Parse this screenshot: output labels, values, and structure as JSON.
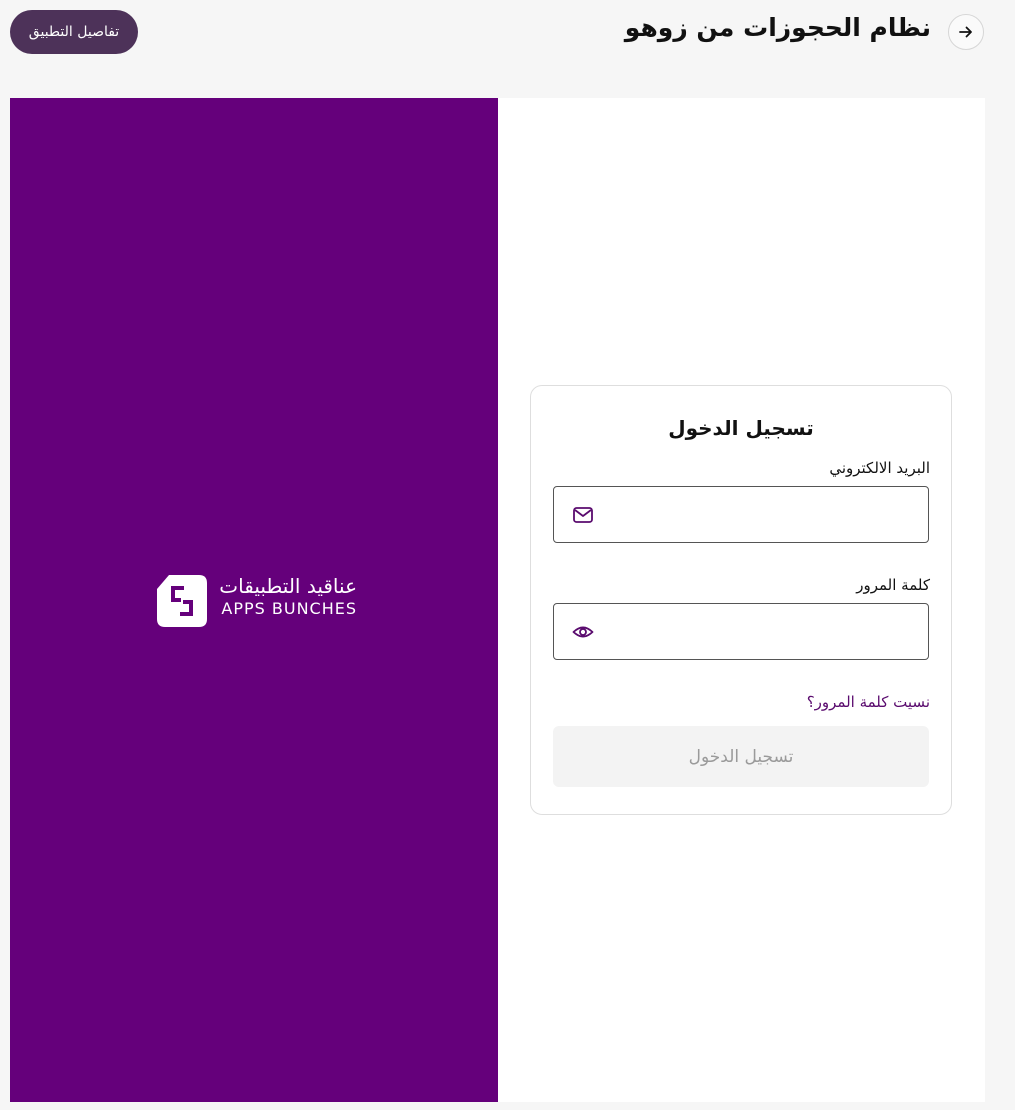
{
  "header": {
    "title": "نظام الحجوزات من زوهو",
    "back_icon": "arrow-right-icon",
    "app_details_label": "تفاصيل التطبيق"
  },
  "brand": {
    "name_ar": "عناقيد التطبيقات",
    "name_en": "APPS BUNCHES",
    "background_color": "#65007b",
    "logo_icon": "apps-bunches-logo"
  },
  "login": {
    "title": "تسجيل الدخول",
    "email_label": "البريد الالكتروني",
    "email_value": "",
    "email_icon": "mail-icon",
    "password_label": "كلمة المرور",
    "password_value": "",
    "password_icon": "eye-icon",
    "forgot_password": "نسيت كلمة المرور؟",
    "submit_label": "تسجيل الدخول",
    "accent_color": "#5a0b6e"
  }
}
